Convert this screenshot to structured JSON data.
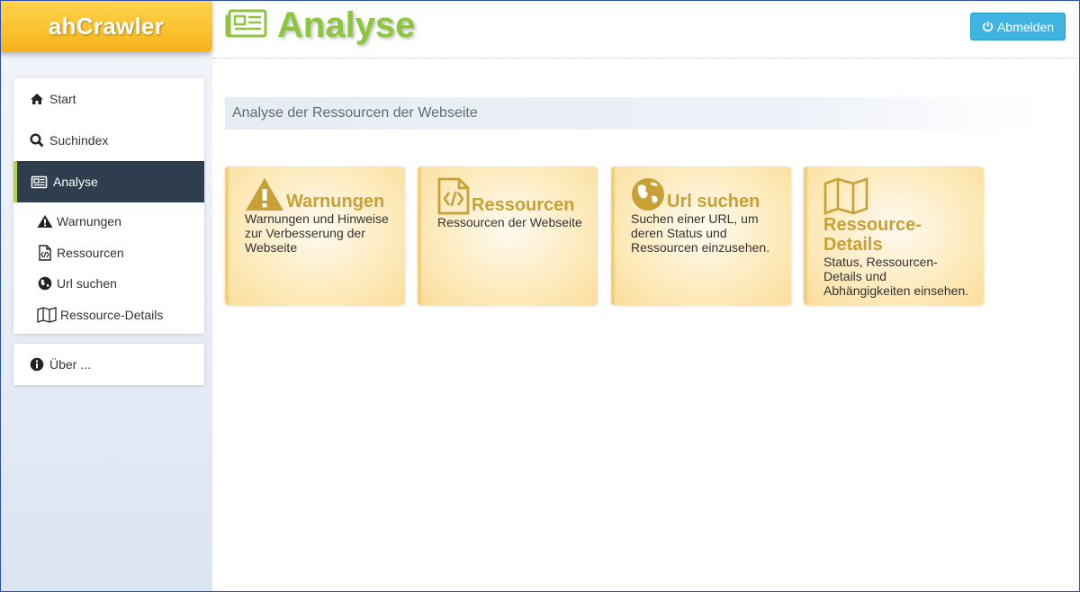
{
  "app": {
    "logo": "ahCrawler"
  },
  "header": {
    "title": "Analyse",
    "logout_label": "Abmelden"
  },
  "nav": {
    "items": [
      {
        "label": "Start",
        "icon": "home-icon"
      },
      {
        "label": "Suchindex",
        "icon": "search-icon"
      },
      {
        "label": "Analyse",
        "icon": "newspaper-icon",
        "active": true
      }
    ],
    "subitems": [
      {
        "label": "Warnungen",
        "icon": "warning-icon"
      },
      {
        "label": "Ressourcen",
        "icon": "file-code-icon"
      },
      {
        "label": "Url suchen",
        "icon": "globe-icon"
      },
      {
        "label": "Ressource-Details",
        "icon": "map-icon"
      }
    ],
    "about": {
      "label": "Über ...",
      "icon": "info-icon"
    }
  },
  "main": {
    "section_title": "Analyse der Ressourcen der Webseite",
    "cards": [
      {
        "title": "Warnungen",
        "description": "Warnungen und Hinweise zur Verbesserung der Webseite",
        "icon": "warning-icon"
      },
      {
        "title": "Ressourcen",
        "description": "Ressourcen der Webseite",
        "icon": "file-code-icon"
      },
      {
        "title": "Url suchen",
        "description": "Suchen einer URL, um deren Status und Ressourcen einzusehen.",
        "icon": "globe-icon"
      },
      {
        "title": "Ressource-Details",
        "description": "Status, Ressourcen-Details und Abhängigkeiten einsehen.",
        "icon": "map-icon"
      }
    ]
  },
  "colors": {
    "accent_green": "#8dc53e",
    "logo_orange": "#f6b21b",
    "button_blue": "#3fb4e2",
    "card_gold": "#c9a035",
    "nav_active": "#2e3e4f"
  }
}
